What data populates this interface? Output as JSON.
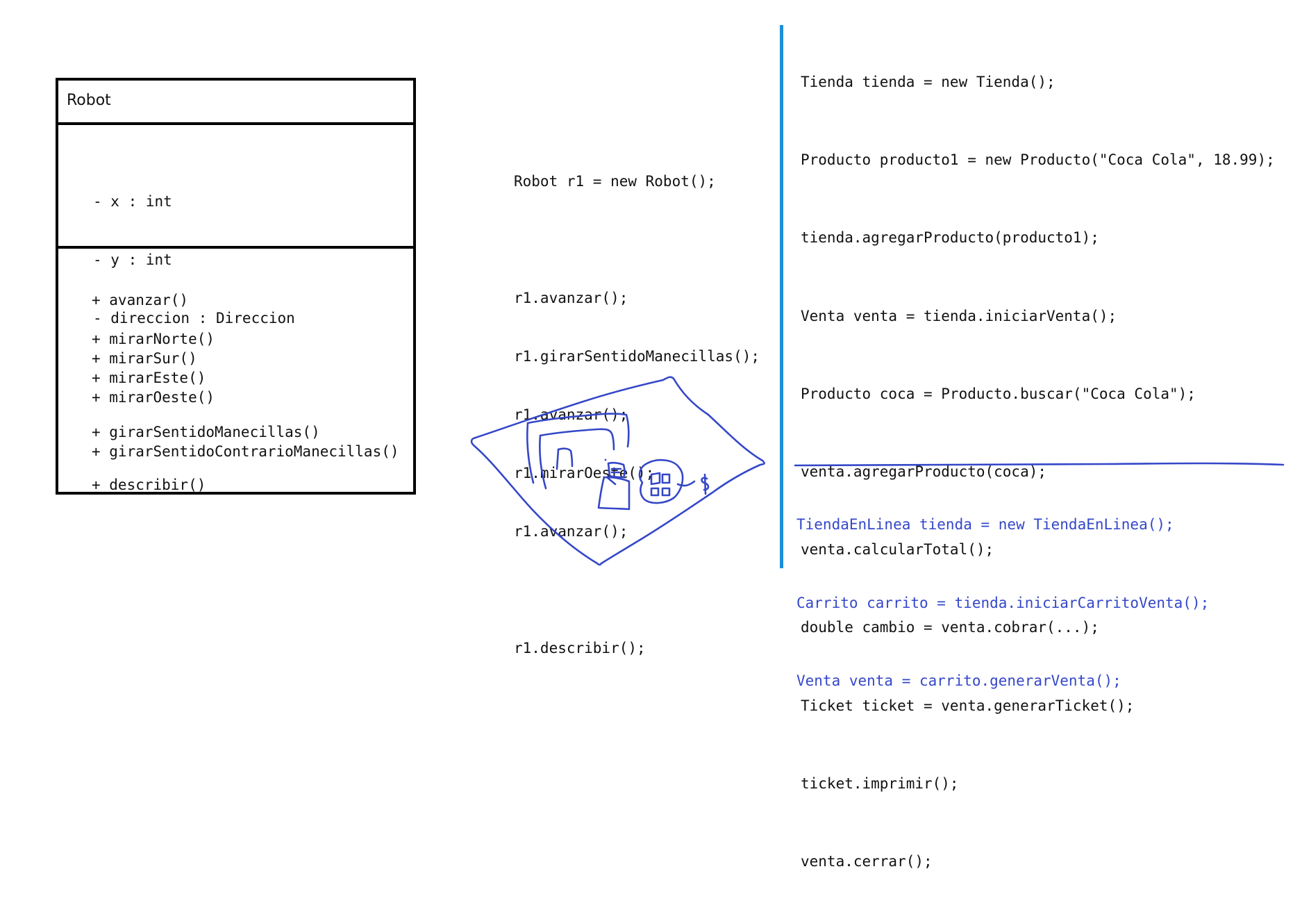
{
  "uml": {
    "class_name": "Robot",
    "attributes": [
      "- x : int",
      "- y : int",
      "- direccion : Direccion"
    ],
    "operations": [
      "+ avanzar()",
      "+ mirarNorte()",
      "+ mirarSur()",
      "+ mirarEste()",
      "+ mirarOeste()",
      "+ girarSentidoManecillas()",
      "+ girarSentidoContrarioManecillas()",
      "+ describir()"
    ]
  },
  "robot_code": [
    "Robot r1 = new Robot();",
    "",
    "r1.avanzar();",
    "r1.girarSentidoManecillas();",
    "r1.avanzar();",
    "r1.mirarOeste();",
    "r1.avanzar();",
    "",
    "r1.describir();"
  ],
  "tienda_code": [
    "Tienda tienda = new Tienda();",
    "Producto producto1 = new Producto(\"Coca Cola\", 18.99);",
    "tienda.agregarProducto(producto1);",
    "Venta venta = tienda.iniciarVenta();",
    "Producto coca = Producto.buscar(\"Coca Cola\");",
    "venta.agregarProducto(coca);",
    "venta.calcularTotal();",
    "double cambio = venta.cobrar(...);",
    "Ticket ticket = venta.generarTicket();",
    "ticket.imprimir();",
    "venta.cerrar();"
  ],
  "online_code": [
    "TiendaEnLinea tienda = new TiendaEnLinea();",
    "Carrito carrito = tienda.iniciarCarritoVenta();",
    "Venta venta = carrito.generarVenta();"
  ],
  "sketch": {
    "dollar_sign": "$"
  },
  "colors": {
    "divider": "#1e8fd8",
    "ink": "#3447c8",
    "text": "#111111"
  }
}
